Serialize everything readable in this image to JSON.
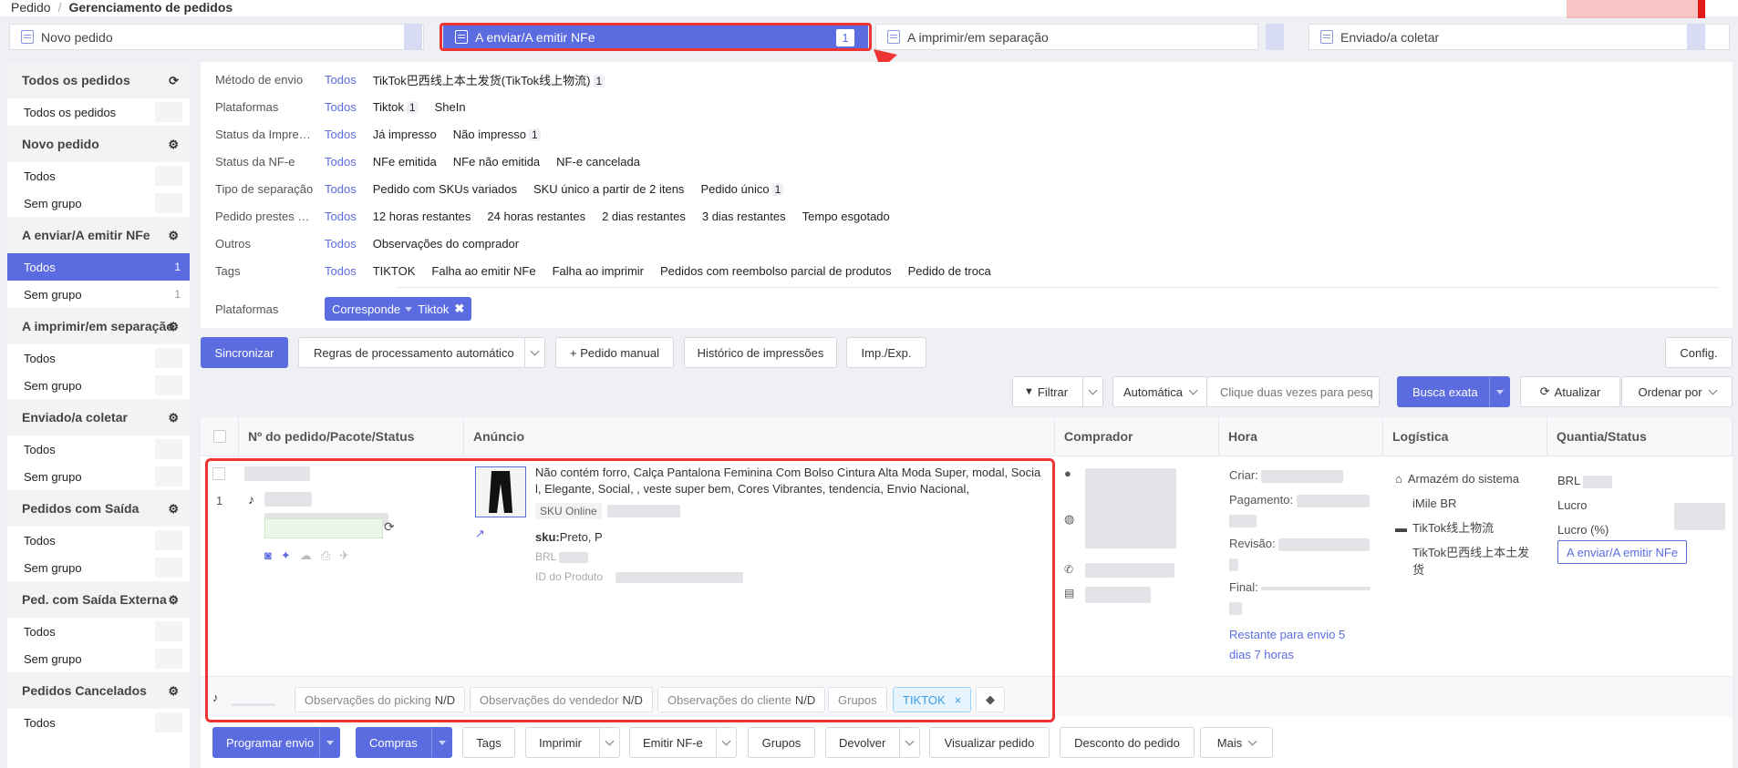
{
  "breadcrumb": {
    "root": "Pedido",
    "current": "Gerenciamento de pedidos"
  },
  "steps": [
    {
      "label": "Novo pedido"
    },
    {
      "label": "A enviar/A emitir NFe",
      "count": "1"
    },
    {
      "label": "A imprimir/em separação"
    },
    {
      "label": "Enviado/a coletar"
    }
  ],
  "sidebar": {
    "groups": [
      {
        "title": "Todos os pedidos",
        "icon": "refresh-icon",
        "items": [
          {
            "label": "Todos os pedidos"
          }
        ]
      },
      {
        "title": "Novo pedido",
        "icon": "gear-icon",
        "items": [
          {
            "label": "Todos"
          },
          {
            "label": "Sem grupo"
          }
        ]
      },
      {
        "title": "A enviar/A emitir NFe",
        "icon": "gear-icon",
        "items": [
          {
            "label": "Todos",
            "count": "1",
            "active": true
          },
          {
            "label": "Sem grupo",
            "count": "1"
          }
        ]
      },
      {
        "title": "A imprimir/em separação",
        "icon": "gear-icon",
        "items": [
          {
            "label": "Todos"
          },
          {
            "label": "Sem grupo"
          }
        ]
      },
      {
        "title": "Enviado/a coletar",
        "icon": "gear-icon",
        "items": [
          {
            "label": "Todos"
          },
          {
            "label": "Sem grupo"
          }
        ]
      },
      {
        "title": "Pedidos com Saída",
        "icon": "gear-icon",
        "items": [
          {
            "label": "Todos"
          },
          {
            "label": "Sem grupo"
          }
        ]
      },
      {
        "title": "Ped. com Saída Externa",
        "icon": "gear-icon",
        "items": [
          {
            "label": "Todos"
          },
          {
            "label": "Sem grupo"
          }
        ]
      },
      {
        "title": "Pedidos Cancelados",
        "icon": "gear-icon",
        "items": [
          {
            "label": "Todos"
          }
        ]
      }
    ]
  },
  "filters": {
    "all_label": "Todos",
    "rows": [
      {
        "label": "Método de envio",
        "options": [
          {
            "text": "TikTok巴西线上本土发货(TikTok线上物流)",
            "count": "1"
          }
        ]
      },
      {
        "label": "Plataformas",
        "options": [
          {
            "text": "Tiktok",
            "count": "1"
          },
          {
            "text": "SheIn"
          }
        ]
      },
      {
        "label": "Status da Impre…",
        "options": [
          {
            "text": "Já impresso"
          },
          {
            "text": "Não impresso",
            "count": "1"
          }
        ]
      },
      {
        "label": "Status da NF-e",
        "options": [
          {
            "text": "NFe emitida"
          },
          {
            "text": "NFe não emitida"
          },
          {
            "text": "NF-e cancelada"
          }
        ]
      },
      {
        "label": "Tipo de separação",
        "options": [
          {
            "text": "Pedido com SKUs variados"
          },
          {
            "text": "SKU único a partir de 2 itens"
          },
          {
            "text": "Pedido único",
            "count": "1"
          }
        ]
      },
      {
        "label": "Pedido prestes …",
        "options": [
          {
            "text": "12 horas restantes"
          },
          {
            "text": "24 horas restantes"
          },
          {
            "text": "2 dias restantes"
          },
          {
            "text": "3 dias restantes"
          },
          {
            "text": "Tempo esgotado"
          }
        ]
      },
      {
        "label": "Outros",
        "options": [
          {
            "text": "Observações do comprador"
          }
        ]
      },
      {
        "label": "Tags",
        "options": [
          {
            "text": "TIKTOK"
          },
          {
            "text": "Falha ao emitir NFe"
          },
          {
            "text": "Falha ao imprimir"
          },
          {
            "text": "Pedidos com reembolso parcial de produtos"
          },
          {
            "text": "Pedido de troca"
          }
        ]
      }
    ],
    "selected_label": "Plataformas",
    "selected_mode": "Corresponde",
    "selected_value": "Tiktok"
  },
  "toolbar": {
    "sync": "Sincronizar",
    "rules": "Regras de processamento automático",
    "manual": "+ Pedido manual",
    "history": "Histórico de impressões",
    "impexp": "Imp./Exp.",
    "config": "Config.",
    "filter": "Filtrar",
    "auto": "Automática",
    "search_placeholder": "Clique duas vezes para pesq",
    "exact": "Busca exata",
    "refresh": "Atualizar",
    "sort": "Ordenar por"
  },
  "table": {
    "headers": [
      "Nº do pedido/Pacote/Status",
      "Anúncio",
      "Comprador",
      "Hora",
      "Logística",
      "Quantia/Status"
    ],
    "row": {
      "index": "1",
      "title": "Não contém forro, Calça Pantalona Feminina Com Bolso Cintura Alta Moda Super, modal, Social, Elegante, Social, , veste super bem, Cores Vibrantes, tendencia, Envio Nacional,",
      "sku_online": "SKU Online",
      "sku_label": "sku:",
      "sku_value": "Preto, P",
      "brl": "BRL",
      "product_id": "ID do Produto",
      "time_create": "Criar:",
      "time_pay": "Pagamento:",
      "time_rev": "Revisão:",
      "time_final": "Final:",
      "remaining": "Restante para envio 5 dias 7 horas",
      "warehouse": "Armazém do sistema",
      "carrier": "iMile BR",
      "log1": "TikTok线上物流",
      "log2": "TikTok巴西线上本土发货",
      "amount": "BRL",
      "profit": "Lucro",
      "profit_pct": "Lucro (%)",
      "status": "A enviar/A emitir NFe"
    },
    "notes": {
      "picking": "Observações do picking",
      "seller": "Observações do vendedor",
      "client": "Observações do cliente",
      "na": "N/D",
      "groups": "Grupos",
      "tag": "TIKTOK"
    }
  },
  "bottom": {
    "ship": "Programar envio",
    "buy": "Compras",
    "tags": "Tags",
    "print": "Imprimir",
    "nfe": "Emitir NF-e",
    "groups": "Grupos",
    "return": "Devolver",
    "view": "Visualizar pedido",
    "discount": "Desconto do pedido",
    "more": "Mais"
  },
  "colors": {
    "primary": "#5b6ce0",
    "highlight": "#e33333"
  }
}
